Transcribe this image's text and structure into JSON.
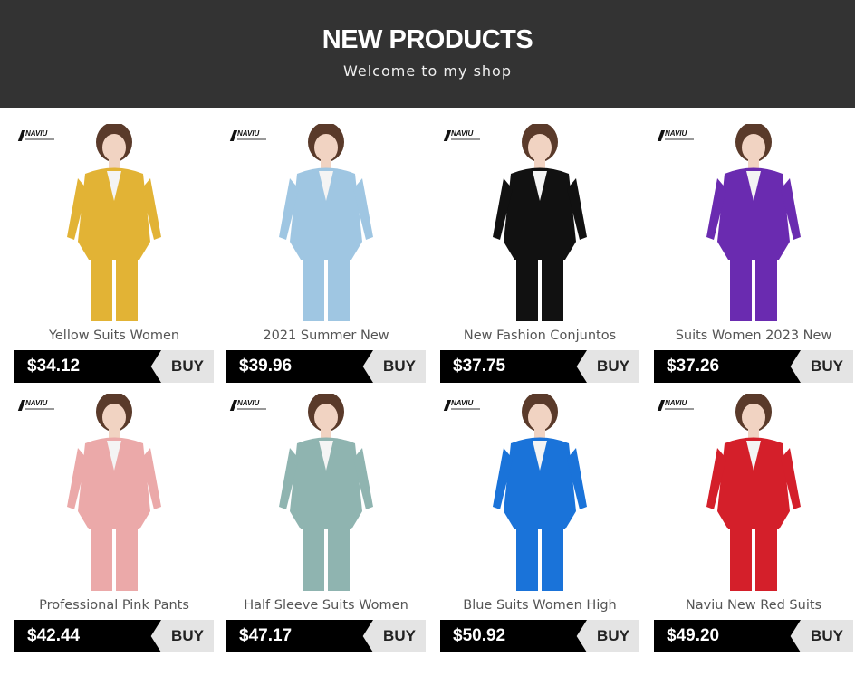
{
  "header": {
    "title": "NEW PRODUCTS",
    "subtitle": "Welcome to my shop"
  },
  "brand": "NAVIU",
  "buy_label": "BUY",
  "products": [
    {
      "name": "Yellow Suits Women",
      "price": "$34.12",
      "color": "#e2b335"
    },
    {
      "name": "2021 Summer New",
      "price": "$39.96",
      "color": "#9fc6e2"
    },
    {
      "name": "New Fashion Conjuntos",
      "price": "$37.75",
      "color": "#111111"
    },
    {
      "name": "Suits Women 2023 New",
      "price": "$37.26",
      "color": "#6a2bb0"
    },
    {
      "name": "Professional Pink Pants",
      "price": "$42.44",
      "color": "#eba9a9"
    },
    {
      "name": "Half Sleeve Suits Women",
      "price": "$47.17",
      "color": "#8fb4b0"
    },
    {
      "name": "Blue Suits Women High",
      "price": "$50.92",
      "color": "#1a73d9"
    },
    {
      "name": "Naviu New Red Suits",
      "price": "$49.20",
      "color": "#d41f2a"
    }
  ]
}
